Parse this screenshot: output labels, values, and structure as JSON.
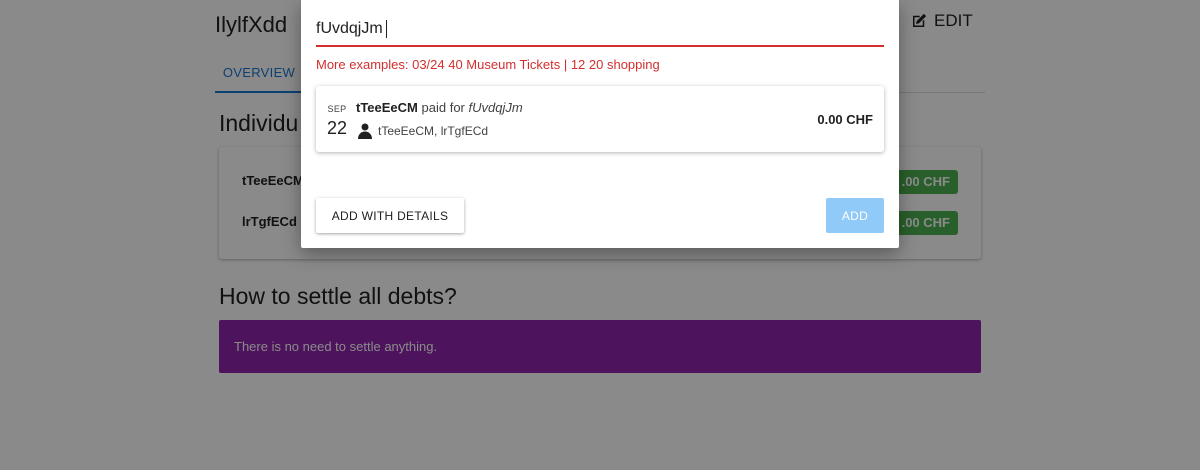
{
  "group": {
    "title": "IlylfXdd",
    "edit_label": "EDIT"
  },
  "tabs": {
    "overview_label": "OVERVIEW"
  },
  "individuals": {
    "title": "Individu",
    "members": [
      {
        "name": "tTeeEeCM",
        "balance": ".00 CHF"
      },
      {
        "name": "lrTgfECd",
        "balance": ".00 CHF"
      }
    ]
  },
  "settle": {
    "title": "How to settle all debts?",
    "message": "There is no need to settle anything."
  },
  "dialog": {
    "input_value": "fUvdqjJm",
    "hint": "More examples: 03/24 40 Museum Tickets | 12 20 shopping",
    "preview": {
      "month": "SEP",
      "day": "22",
      "payer": "tTeeEeCM",
      "paid_for": "paid for",
      "description": "fUvdqjJm",
      "participants": "tTeeEeCM, lrTgfECd",
      "amount": "0.00 CHF"
    },
    "add_with_details_label": "ADD WITH DETAILS",
    "add_label": "ADD"
  },
  "colors": {
    "accent": "#1976d2",
    "error": "#d32f2f",
    "positive_badge": "#4caf50",
    "alert": "#8e24aa",
    "add_button_disabled": "#90caf9"
  }
}
